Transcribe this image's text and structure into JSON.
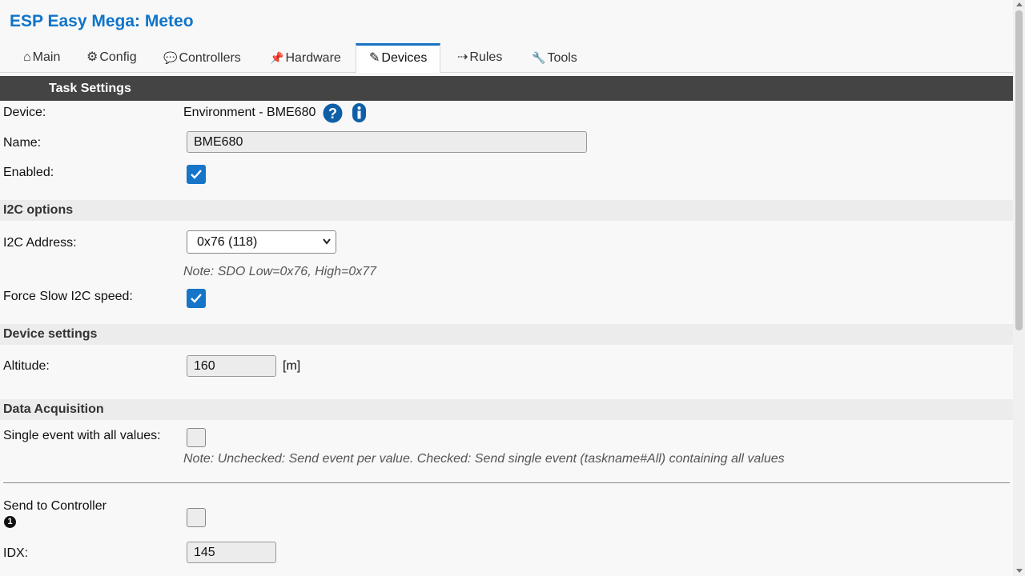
{
  "app_title": "ESP Easy Mega: Meteo",
  "tabs": [
    {
      "icon": "⌂",
      "label": "Main"
    },
    {
      "icon": "⚙",
      "label": "Config"
    },
    {
      "icon": "💬",
      "label": "Controllers"
    },
    {
      "icon": "📌",
      "label": "Hardware"
    },
    {
      "icon": "✎",
      "label": "Devices"
    },
    {
      "icon": "⇢",
      "label": "Rules"
    },
    {
      "icon": "🔧",
      "label": "Tools"
    }
  ],
  "active_tab": "Devices",
  "header": "Task Settings",
  "device": {
    "label": "Device:",
    "value": "Environment - BME680",
    "help_icon": "question-circle-icon",
    "info_icon": "info-circle-icon"
  },
  "name": {
    "label": "Name:",
    "value": "BME680"
  },
  "enabled": {
    "label": "Enabled:",
    "checked": true
  },
  "i2c": {
    "section": "I2C options",
    "address_label": "I2C Address:",
    "address_value": "0x76 (118)",
    "note": "Note: SDO Low=0x76, High=0x77",
    "force_slow_label": "Force Slow I2C speed:",
    "force_slow_checked": true
  },
  "device_settings": {
    "section": "Device settings",
    "altitude_label": "Altitude:",
    "altitude_value": "160",
    "altitude_unit": "[m]"
  },
  "data_acquisition": {
    "section": "Data Acquisition",
    "single_event_label": "Single event with all values:",
    "single_event_checked": false,
    "note": "Note: Unchecked: Send event per value. Checked: Send single event (taskname#All) containing all values",
    "send_controller_label": "Send to Controller",
    "send_controller_number": "1",
    "send_controller_checked": false,
    "idx_label": "IDX:",
    "idx_value": "145"
  },
  "colors": {
    "accent": "#0f74c9",
    "header_bg": "#444444",
    "section_bg": "#ececec",
    "checkbox_on": "#1675c9"
  }
}
